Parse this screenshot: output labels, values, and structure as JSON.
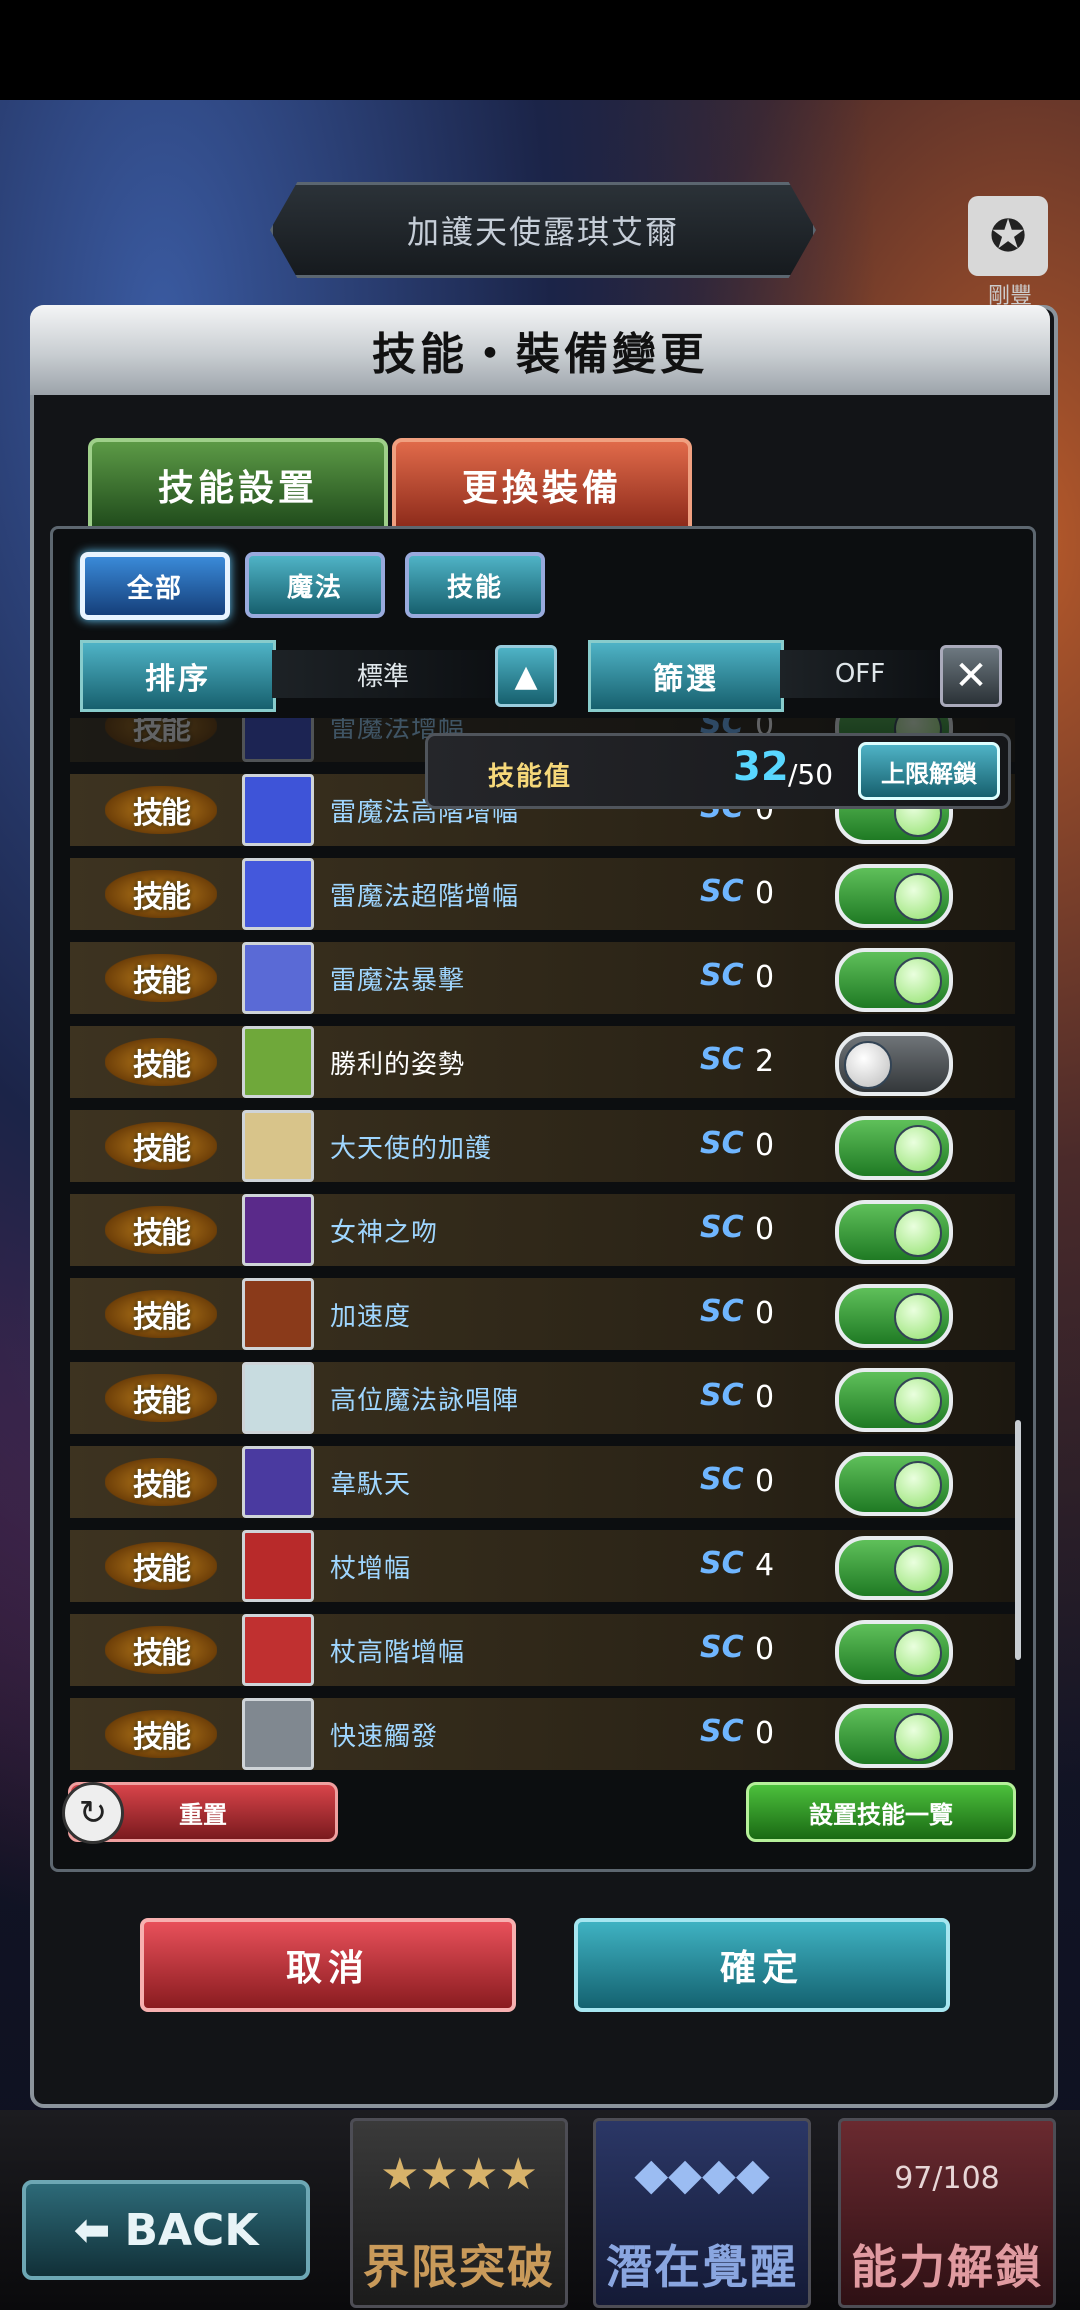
{
  "character_title": "加護天使露琪艾爾",
  "side_icon": {
    "glyph": "✪",
    "label": "剛豐"
  },
  "dialog": {
    "title": "技能・裝備變更",
    "tabs": [
      "技能設置",
      "更換裝備"
    ],
    "filters": [
      "全部",
      "魔法",
      "技能"
    ],
    "sort": {
      "label": "排序",
      "value": "標準",
      "button_icon": "▲"
    },
    "screen": {
      "label": "篩選",
      "value": "OFF",
      "button_icon": "✕"
    },
    "skill_points": {
      "label": "技能值",
      "current": "32",
      "max": "/50",
      "unlock_label": "上限解鎖"
    },
    "row_tag": "技能",
    "sc_label": "SC",
    "skills": [
      {
        "name": "雷魔法增幅",
        "sc": "0",
        "on": true,
        "thumb": "#3a4fd0"
      },
      {
        "name": "雷魔法高階增幅",
        "sc": "0",
        "on": true,
        "thumb": "#3e54d8"
      },
      {
        "name": "雷魔法超階增幅",
        "sc": "0",
        "on": true,
        "thumb": "#4458dc"
      },
      {
        "name": "雷魔法暴擊",
        "sc": "0",
        "on": true,
        "thumb": "#5a6ad6"
      },
      {
        "name": "勝利的姿勢",
        "sc": "2",
        "on": false,
        "thumb": "#6fa83a"
      },
      {
        "name": "大天使的加護",
        "sc": "0",
        "on": true,
        "thumb": "#d8c48a"
      },
      {
        "name": "女神之吻",
        "sc": "0",
        "on": true,
        "thumb": "#5a2a8a"
      },
      {
        "name": "加速度",
        "sc": "0",
        "on": true,
        "thumb": "#8a3a1a"
      },
      {
        "name": "高位魔法詠唱陣",
        "sc": "0",
        "on": true,
        "thumb": "#c8dce0"
      },
      {
        "name": "韋馱天",
        "sc": "0",
        "on": true,
        "thumb": "#4a3aa0"
      },
      {
        "name": "杖增幅",
        "sc": "4",
        "on": true,
        "thumb": "#b82a2a"
      },
      {
        "name": "杖高階增幅",
        "sc": "0",
        "on": true,
        "thumb": "#c03030"
      },
      {
        "name": "快速觸發",
        "sc": "0",
        "on": true,
        "thumb": "#808890"
      }
    ],
    "reset_label": "重置",
    "reset_icon": "↻",
    "list_label": "設置技能一覽",
    "cancel_label": "取消",
    "ok_label": "確定"
  },
  "bottom": {
    "back_label": "BACK",
    "back_icon": "⬅",
    "menu": [
      {
        "top": "★★★★",
        "label": "界限突破"
      },
      {
        "top": "◆◆◆◆",
        "label": "潛在覺醒"
      },
      {
        "top": "97/108",
        "label": "能力解鎖"
      }
    ]
  }
}
